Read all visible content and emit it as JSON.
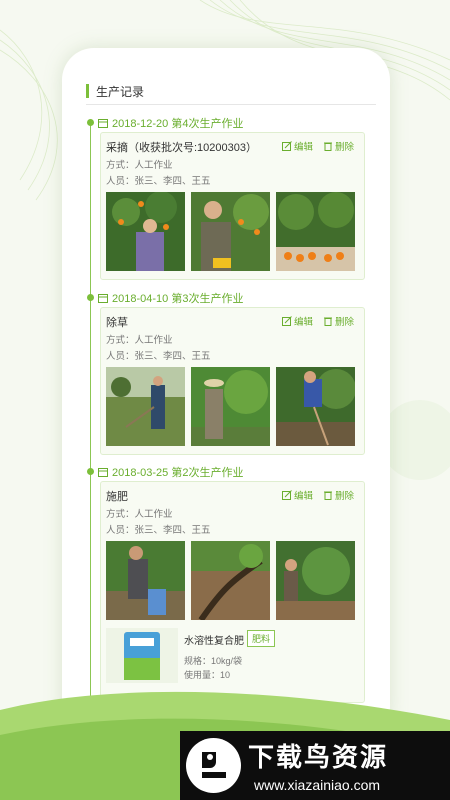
{
  "header": {
    "title": "生产记录"
  },
  "records": [
    {
      "date": "2018-12-20 第4次生产作业",
      "title": "采摘（收获批次号:10200303）",
      "method": "方式：人工作业",
      "people": "人员：张三、李四、王五",
      "edit_label": "编辑",
      "delete_label": "删除"
    },
    {
      "date": "2018-04-10 第3次生产作业",
      "title": "除草",
      "method": "方式：人工作业",
      "people": "人员：张三、李四、王五",
      "edit_label": "编辑",
      "delete_label": "删除"
    },
    {
      "date": "2018-03-25 第2次生产作业",
      "title": "施肥",
      "method": "方式：人工作业",
      "people": "人员：张三、李四、王五",
      "edit_label": "编辑",
      "delete_label": "删除",
      "product": {
        "name": "水溶性复合肥",
        "badge": "肥料",
        "spec": "规格：10kg/袋",
        "usage": "使用量：10"
      }
    }
  ],
  "brand": {
    "name": "下载鸟资源",
    "url": "www.xiazainiao.com"
  },
  "colors": {
    "accent": "#7cbf3a",
    "text": "#333333",
    "muted": "#777777"
  }
}
